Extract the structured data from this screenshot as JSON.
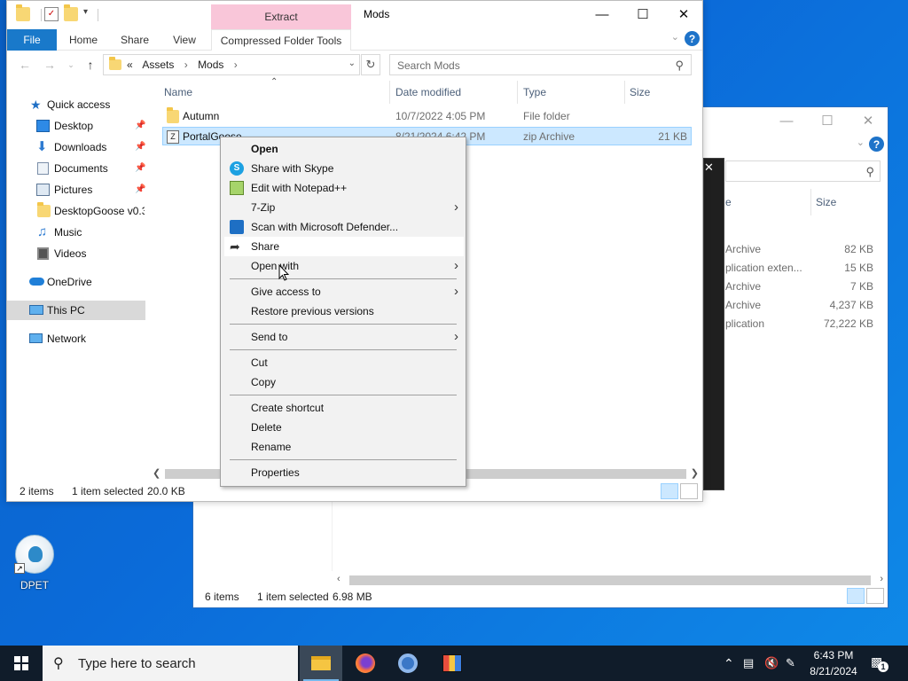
{
  "main_window": {
    "title": "Mods",
    "context_tab": "Extract",
    "ribbon_tabs": [
      "File",
      "Home",
      "Share",
      "View",
      "Compressed Folder Tools"
    ],
    "address": {
      "prefix": "«",
      "crumbs": [
        "Assets",
        "Mods"
      ]
    },
    "search_placeholder": "Search Mods",
    "nav_pane": [
      {
        "label": "Quick access",
        "icon": "star-icon",
        "pinned": false
      },
      {
        "label": "Desktop",
        "icon": "desktop-icon",
        "pinned": true
      },
      {
        "label": "Downloads",
        "icon": "download-icon",
        "pinned": true
      },
      {
        "label": "Documents",
        "icon": "documents-icon",
        "pinned": true
      },
      {
        "label": "Pictures",
        "icon": "pictures-icon",
        "pinned": true
      },
      {
        "label": "DesktopGoose v0.3",
        "icon": "folder-icon",
        "pinned": false
      },
      {
        "label": "Music",
        "icon": "music-icon",
        "pinned": false
      },
      {
        "label": "Videos",
        "icon": "videos-icon",
        "pinned": false
      },
      {
        "label": "OneDrive",
        "icon": "cloud-icon",
        "pinned": false
      },
      {
        "label": "This PC",
        "icon": "pc-icon",
        "pinned": false
      },
      {
        "label": "Network",
        "icon": "network-icon",
        "pinned": false
      }
    ],
    "columns": [
      "Name",
      "Date modified",
      "Type",
      "Size"
    ],
    "files": [
      {
        "name": "Autumn",
        "date": "10/7/2022 4:05 PM",
        "type": "File folder",
        "size": ""
      },
      {
        "name": "PortalGoose",
        "date": "8/21/2024 6:42 PM",
        "type": "zip Archive",
        "size": "21 KB"
      }
    ],
    "status": {
      "count": "2 items",
      "selected": "1 item selected",
      "size": "20.0 KB"
    }
  },
  "context_menu": {
    "items": [
      {
        "label": "Open",
        "bold": true
      },
      {
        "label": "Share with Skype",
        "icon": "skype-icon"
      },
      {
        "label": "Edit with Notepad++",
        "icon": "notepad-icon"
      },
      {
        "label": "7-Zip",
        "submenu": true
      },
      {
        "label": "Scan with Microsoft Defender...",
        "icon": "defender-icon"
      },
      {
        "label": "Share",
        "icon": "share-icon"
      },
      {
        "label": "Open with",
        "submenu": true
      },
      {
        "label": "Give access to",
        "submenu": true
      },
      {
        "label": "Restore previous versions"
      },
      {
        "label": "Send to",
        "submenu": true
      },
      {
        "label": "Cut"
      },
      {
        "label": "Copy"
      },
      {
        "label": "Create shortcut"
      },
      {
        "label": "Delete"
      },
      {
        "label": "Rename"
      },
      {
        "label": "Properties"
      }
    ]
  },
  "background_window": {
    "column_size": "Size",
    "rows": [
      {
        "type": "Archive",
        "size": "82 KB"
      },
      {
        "type": "plication exten...",
        "size": "15 KB"
      },
      {
        "type": "Archive",
        "size": "7 KB"
      },
      {
        "type": "Archive",
        "size": "4,237 KB"
      },
      {
        "type": "plication",
        "size": "72,222 KB"
      }
    ],
    "status": {
      "count": "6 items",
      "selected": "1 item selected",
      "size": "6.98 MB"
    }
  },
  "desktop_icon": {
    "label": "DPET"
  },
  "taskbar": {
    "search_placeholder": "Type here to search",
    "apps": [
      "file-explorer-icon",
      "firefox-icon",
      "chrome-icon",
      "app-icon"
    ],
    "time": "6:43 PM",
    "date": "8/21/2024",
    "notifications": "1"
  },
  "colors": {
    "accent": "#1979ca",
    "extract_tab": "#f9c6d9",
    "selection": "#cce8ff",
    "taskbar": "#101c2a"
  }
}
